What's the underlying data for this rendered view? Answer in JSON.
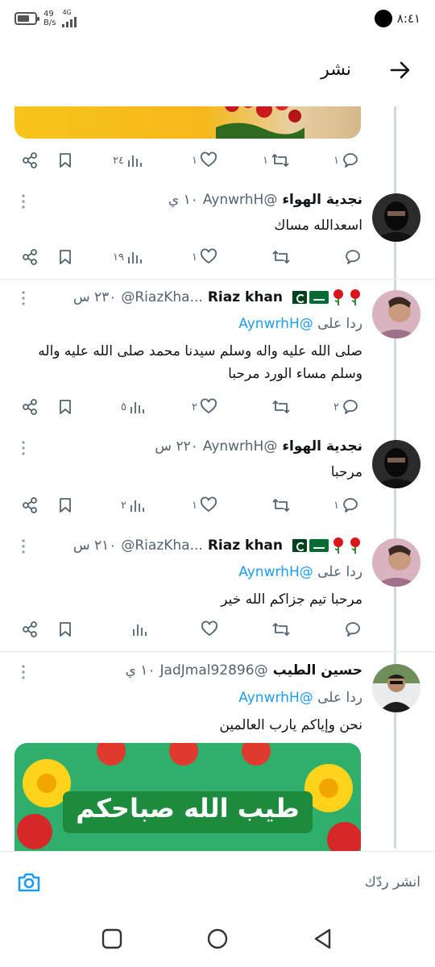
{
  "status_bar": {
    "network_speed_top": "49",
    "network_speed_bottom": "B/s",
    "network_type": "4G",
    "time": "٨:٤١"
  },
  "header": {
    "title": "نشر",
    "back_icon": "arrow-right-icon"
  },
  "top_post_actions": {
    "reply": "١",
    "retweet": "١",
    "like": "١",
    "views": "٢٤"
  },
  "tweets": [
    {
      "name": "نجدية الهواء",
      "handle": "@AynwrhH",
      "time": "١٠ ي",
      "replying_prefix": "",
      "replying_to": "",
      "text": "اسعدالله مساك",
      "actions": {
        "reply": "",
        "retweet": "",
        "like": "١",
        "views": "١٩"
      }
    },
    {
      "name": "Riaz khan",
      "handle": "@RiazKha...",
      "time": "٢٣٠ س",
      "replying_prefix": "ردا على",
      "replying_to": "@AynwrhH",
      "text": "صلى الله عليه واله وسلم سيدنا محمد صلى الله عليه واله وسلم مساء الورد مرحبا",
      "actions": {
        "reply": "٢",
        "retweet": "",
        "like": "٢",
        "views": "٥"
      }
    },
    {
      "name": "نجدية الهواء",
      "handle": "@AynwrhH",
      "time": "٢٢٠ س",
      "replying_prefix": "",
      "replying_to": "",
      "text": "مرحبا",
      "actions": {
        "reply": "١",
        "retweet": "",
        "like": "١",
        "views": "٢"
      }
    },
    {
      "name": "Riaz khan",
      "handle": "@RiazKha...",
      "time": "٢١٠ س",
      "replying_prefix": "ردا على",
      "replying_to": "@AynwrhH",
      "text": "مرحبا تيم جزاكم الله خير",
      "actions": {
        "reply": "",
        "retweet": "",
        "like": "",
        "views": ""
      }
    },
    {
      "name": "حسين الطيب",
      "handle": "@JadJmal92896",
      "time": "١٠ ي",
      "replying_prefix": "ردا على",
      "replying_to": "@AynwrhH",
      "text": "نحن وإياكم يارب العالمين",
      "image_text": "طيب الله صباحكم"
    }
  ],
  "reply_bar": {
    "placeholder": "انشر ردّك",
    "camera_icon": "camera-icon"
  },
  "nav": {
    "recents": "square-icon",
    "home": "circle-icon",
    "back": "triangle-back-icon"
  },
  "colors": {
    "accent": "#1d9bf0",
    "muted_text": "#536471",
    "primary_text": "#0f1419",
    "divider": "#e6ecf0"
  }
}
